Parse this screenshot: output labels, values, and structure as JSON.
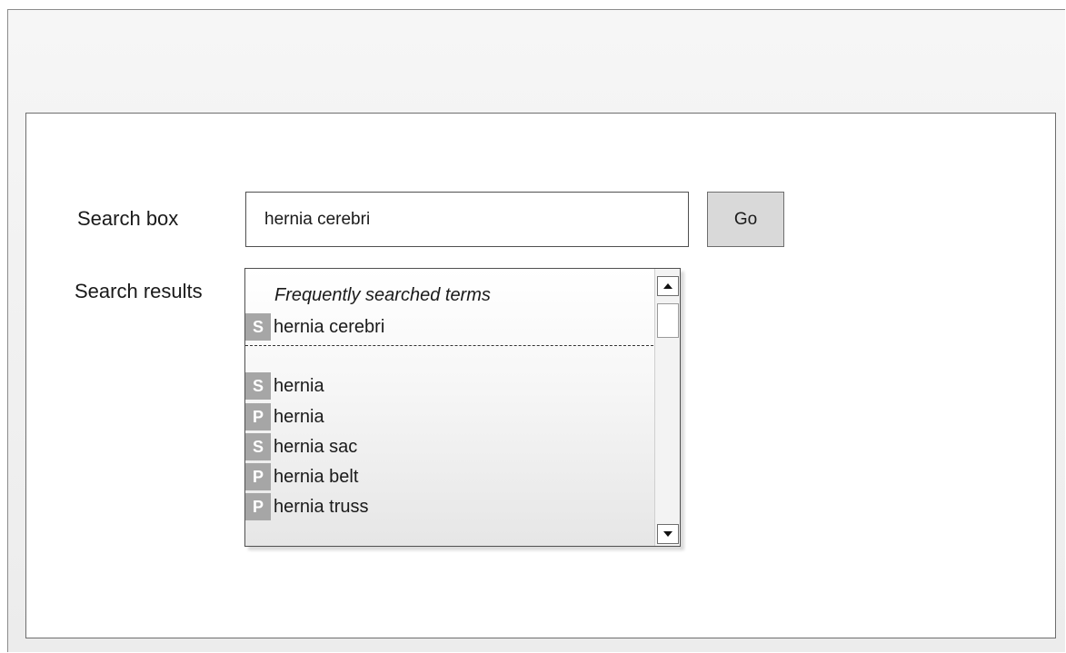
{
  "search": {
    "label": "Search box",
    "value": "hernia cerebri",
    "go_label": "Go"
  },
  "results": {
    "label": "Search results",
    "heading": "Frequently searched terms",
    "frequent": [
      {
        "badge": "S",
        "text": "hernia cerebri"
      }
    ],
    "items": [
      {
        "badge": "S",
        "text": "hernia"
      },
      {
        "badge": "P",
        "text": "hernia"
      },
      {
        "badge": "S",
        "text": "hernia sac"
      },
      {
        "badge": "P",
        "text": "hernia belt"
      },
      {
        "badge": "P",
        "text": "hernia truss"
      }
    ]
  },
  "icons": {
    "scroll_up": "triangle-up-icon",
    "scroll_down": "triangle-down-icon"
  },
  "colors": {
    "badge_bg": "#a6a6a6",
    "go_button_bg": "#d9d9d9"
  }
}
